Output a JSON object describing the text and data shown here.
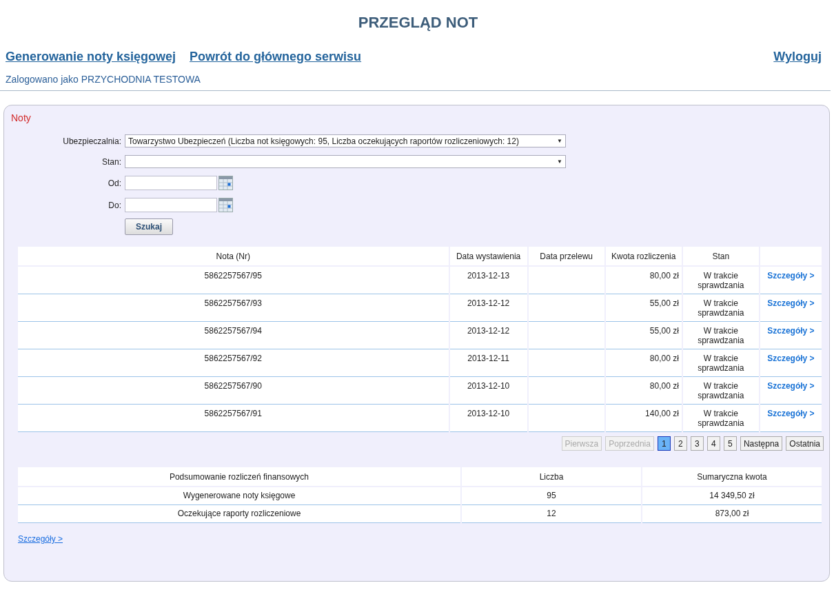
{
  "title": "PRZEGLĄD NOT",
  "nav": {
    "links": [
      {
        "label": "Generowanie noty księgowej"
      },
      {
        "label": "Powrót do głównego serwisu"
      }
    ],
    "logout": "Wyloguj"
  },
  "logged_in": "Zalogowano jako PRZYCHODNIA TESTOWA",
  "panel": {
    "title": "Noty",
    "filters": [
      {
        "kind": "select",
        "label": "Ubezpieczalnia:",
        "value": "Towarzystwo Ubezpieczeń (Liczba not księgowych: 95, Liczba oczekujących raportów rozliczeniowych: 12)",
        "arrow": "▼"
      },
      {
        "kind": "select",
        "label": "Stan:",
        "arrow": "▼"
      },
      {
        "kind": "date",
        "label": "Od:"
      },
      {
        "kind": "date",
        "label": "Do:"
      }
    ],
    "search_button": "Szukaj",
    "table": {
      "columns": [
        "Nota (Nr)",
        "Data wystawienia",
        "Data przelewu",
        "Kwota rozliczenia",
        "Stan"
      ],
      "rows": [
        {
          "number": "5862257567/95",
          "issued": "2013-12-13",
          "amount": "80,00 zł",
          "status": "W trakcie sprawdzania",
          "link": "Szczegóły >"
        },
        {
          "number": "5862257567/93",
          "issued": "2013-12-12",
          "amount": "55,00 zł",
          "status": "W trakcie sprawdzania",
          "link": "Szczegóły >"
        },
        {
          "number": "5862257567/94",
          "issued": "2013-12-12",
          "amount": "55,00 zł",
          "status": "W trakcie sprawdzania",
          "link": "Szczegóły >"
        },
        {
          "number": "5862257567/92",
          "issued": "2013-12-11",
          "amount": "80,00 zł",
          "status": "W trakcie sprawdzania",
          "link": "Szczegóły >"
        },
        {
          "number": "5862257567/90",
          "issued": "2013-12-10",
          "amount": "80,00 zł",
          "status": "W trakcie sprawdzania",
          "link": "Szczegóły >"
        },
        {
          "number": "5862257567/91",
          "issued": "2013-12-10",
          "amount": "140,00 zł",
          "status": "W trakcie sprawdzania",
          "link": "Szczegóły >"
        }
      ]
    },
    "pagination": [
      {
        "label": "Pierwsza",
        "selected": false,
        "disabled": true
      },
      {
        "label": "Poprzednia",
        "selected": false,
        "disabled": true
      },
      {
        "label": "1",
        "selected": true,
        "disabled": false
      },
      {
        "label": "2",
        "selected": false,
        "disabled": false
      },
      {
        "label": "3",
        "selected": false,
        "disabled": false
      },
      {
        "label": "4",
        "selected": false,
        "disabled": false
      },
      {
        "label": "5",
        "selected": false,
        "disabled": false
      },
      {
        "label": "Następna",
        "selected": false,
        "disabled": false
      },
      {
        "label": "Ostatnia",
        "selected": false,
        "disabled": false
      }
    ],
    "summary": {
      "columns": [
        "Podsumowanie rozliczeń finansowych",
        "Liczba",
        "Sumaryczna kwota"
      ],
      "rows": [
        [
          "Wygenerowane noty księgowe",
          "95",
          "14 349,50 zł"
        ],
        [
          "Oczekujące raporty rozliczeniowe",
          "12",
          "873,00 zł"
        ]
      ]
    },
    "details_link": "Szczegóły >"
  }
}
